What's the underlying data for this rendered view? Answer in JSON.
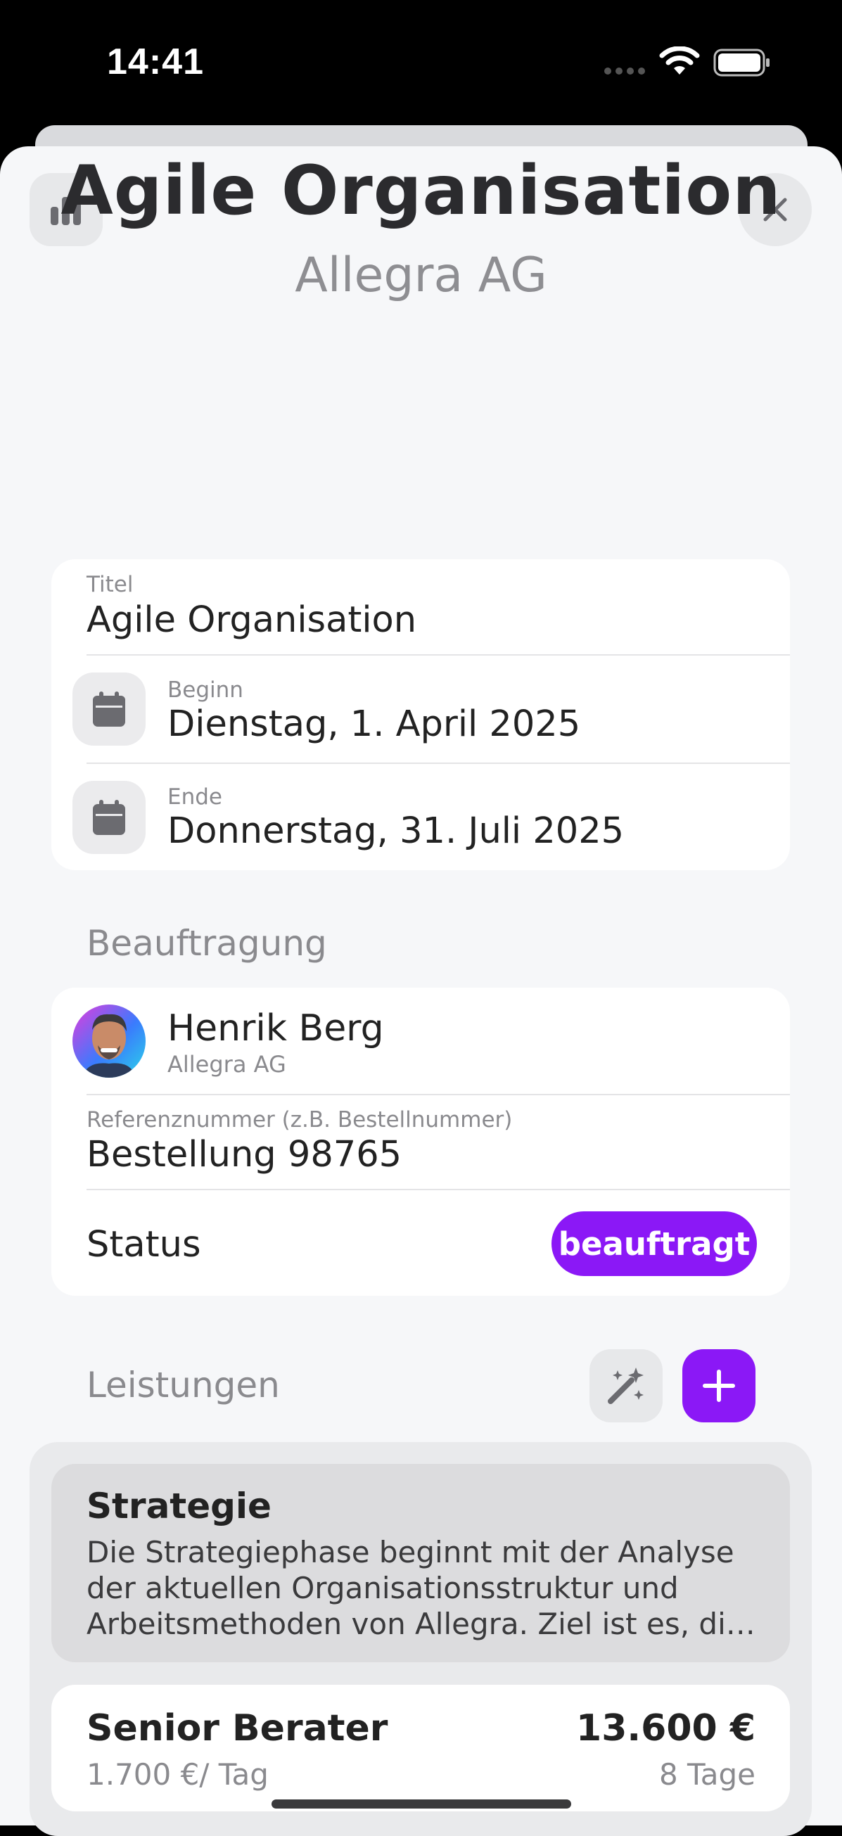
{
  "status_bar": {
    "time": "14:41"
  },
  "header": {
    "title": "Agile Organisation",
    "subtitle": "Allegra AG"
  },
  "details": {
    "title_label": "Titel",
    "title_value": "Agile Organisation",
    "start_label": "Beginn",
    "start_value": "Dienstag, 1. April 2025",
    "end_label": "Ende",
    "end_value": "Donnerstag, 31. Juli 2025"
  },
  "assignment": {
    "section_label": "Beauftragung",
    "person_name": "Henrik Berg",
    "person_company": "Allegra AG",
    "reference_label": "Referenznummer (z.B. Bestellnummer)",
    "reference_value": "Bestellung 98765",
    "status_label": "Status",
    "status_value": "beauftragt"
  },
  "services": {
    "section_label": "Leistungen",
    "items": [
      {
        "title": "Strategie",
        "description": "Die Strategiephase beginnt mit der Analyse der aktuellen Organisationsstruktur und Arbeitsmethoden von Allegra. Ziel ist es, di…"
      },
      {
        "role": "Senior Berater",
        "rate": "1.700 €/ Tag",
        "total": "13.600 €",
        "days": "8 Tage"
      }
    ]
  },
  "colors": {
    "accent": "#8b18f6",
    "background": "#f6f7f9",
    "card": "#ffffff"
  },
  "icons": [
    "chart-icon",
    "close-icon",
    "calendar-icon",
    "magic-wand-icon",
    "plus-icon"
  ]
}
